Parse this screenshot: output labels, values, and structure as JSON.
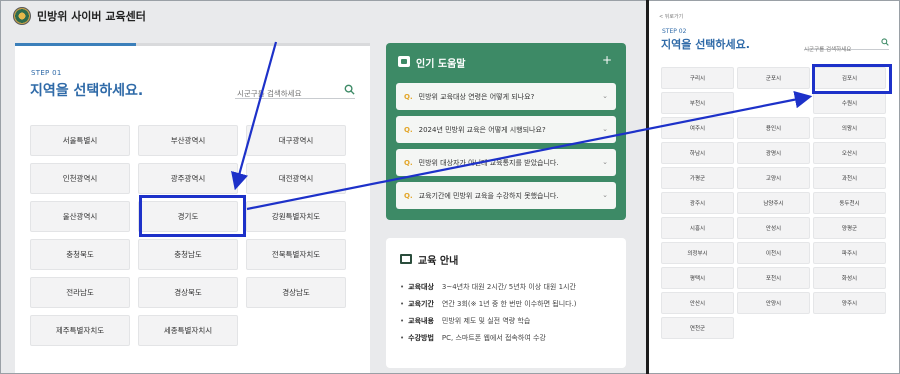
{
  "app": {
    "title": "민방위 사이버 교육센터"
  },
  "step1": {
    "label": "STEP 01",
    "title": "지역을 선택하세요.",
    "progress": 0.34,
    "search_placeholder": "시군구를 검색하세요",
    "regions": [
      "서울특별시",
      "부산광역시",
      "대구광역시",
      "인천광역시",
      "광주광역시",
      "대전광역시",
      "울산광역시",
      "경기도",
      "강원특별자치도",
      "충청북도",
      "충청남도",
      "전북특별자치도",
      "전라남도",
      "경상북도",
      "경상남도",
      "제주특별자치도",
      "세종특별자치시"
    ],
    "selected": "경기도"
  },
  "help": {
    "title": "인기 도움말",
    "plus": "+",
    "q_marker": "Q.",
    "faqs": [
      "민방위 교육대상 연령은 어떻게 되나요?",
      "2024년 민방위 교육은 어떻게 시행되나요?",
      "민방위 대상자가 아닌데 교육통지를 받았습니다.",
      "교육기간에 민방위 교육을 수강하지 못했습니다."
    ]
  },
  "edu": {
    "title": "교육 안내",
    "rows": [
      {
        "key": "교육대상",
        "value": "3~4년차 대원 2시간/ 5년차 이상 대원 1시간"
      },
      {
        "key": "교육기간",
        "value": "연간 3회(※ 1년 중 한 번만 이수하면 됩니다.)"
      },
      {
        "key": "교육내용",
        "value": "민방위 제도 및 실전 역량 학습"
      },
      {
        "key": "수강방법",
        "value": "PC, 스마트폰 웹에서 접속하여 수강"
      }
    ]
  },
  "step2": {
    "back": "< 뒤로가기",
    "label": "STEP 02",
    "title": "지역을 선택하세요.",
    "search_placeholder": "시군구를 검색하세요",
    "cities": [
      "구리시",
      "군포시",
      "김포시",
      "부천시",
      "",
      "수원시",
      "여주시",
      "용인시",
      "의왕시",
      "하남시",
      "광명시",
      "오산시",
      "가평군",
      "고양시",
      "과천시",
      "광주시",
      "남양주시",
      "동두천시",
      "시흥시",
      "안성시",
      "양평군",
      "의정부시",
      "이천시",
      "파주시",
      "평택시",
      "포천시",
      "화성시",
      "안산시",
      "안양시",
      "양주시",
      "연천군"
    ],
    "selected": "김포시"
  },
  "colors": {
    "accent": "#2f6aa8",
    "help_bg": "#3d8a66",
    "highlight": "#1d31c9"
  }
}
